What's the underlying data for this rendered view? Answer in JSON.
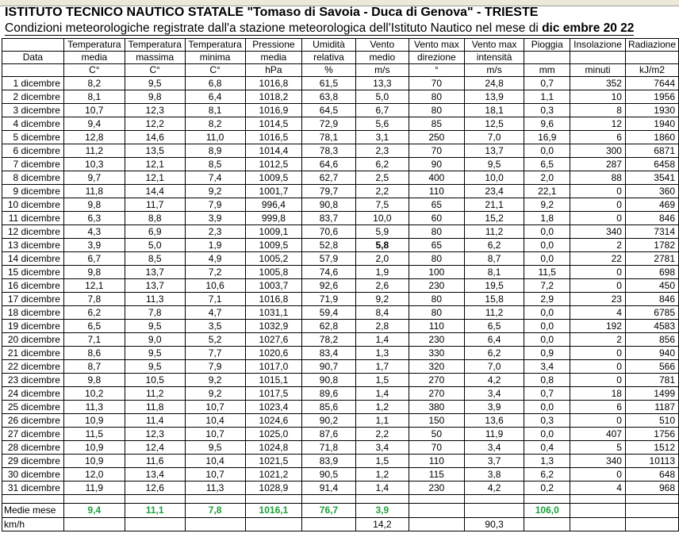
{
  "title": "ISTITUTO TECNICO NAUTICO STATALE \"Tomaso di Savoia - Duca di Genova\"  -  TRIESTE",
  "subtitle_main": "Condizioni meteorologiche registrate dall'a stazione meteorologica dell'Istituto Nautico nel mese di ",
  "subtitle_bold": "dic embre 20 22",
  "headers_row1": [
    "",
    "Temperatura",
    "Temperatura",
    "Temperatura",
    "Pressione",
    "Umidità",
    "Vento",
    "Vento max",
    "Vento max",
    "Pioggia",
    "Insolazione",
    "Radiazione"
  ],
  "headers_row2": [
    "Data",
    "media",
    "massima",
    "minima",
    "media",
    "relativa",
    "medio",
    "direzione",
    "intensità",
    "",
    "",
    ""
  ],
  "headers_row3": [
    "",
    "C°",
    "C°",
    "C°",
    "hPa",
    "%",
    "m/s",
    "°",
    "m/s",
    "mm",
    "minuti",
    "kJ/m2"
  ],
  "rows": [
    [
      "1 dicembre",
      "8,2",
      "9,5",
      "6,8",
      "1016,8",
      "61,5",
      "13,3",
      "70",
      "24,8",
      "0,7",
      "352",
      "7644"
    ],
    [
      "2 dicembre",
      "8,1",
      "9,8",
      "6,4",
      "1018,2",
      "63,8",
      "5,0",
      "80",
      "13,9",
      "1,1",
      "10",
      "1956"
    ],
    [
      "3 dicembre",
      "10,7",
      "12,3",
      "8,1",
      "1016,9",
      "64,5",
      "6,7",
      "80",
      "18,1",
      "0,3",
      "8",
      "1930"
    ],
    [
      "4 dicembre",
      "9,4",
      "12,2",
      "8,2",
      "1014,5",
      "72,9",
      "5,6",
      "85",
      "12,5",
      "9,6",
      "12",
      "1940"
    ],
    [
      "5 dicembre",
      "12,8",
      "14,6",
      "11,0",
      "1016,5",
      "78,1",
      "3,1",
      "250",
      "7,0",
      "16,9",
      "6",
      "1860"
    ],
    [
      "6 dicembre",
      "11,2",
      "13,5",
      "8,9",
      "1014,4",
      "78,3",
      "2,3",
      "70",
      "13,7",
      "0,0",
      "300",
      "6871"
    ],
    [
      "7 dicembre",
      "10,3",
      "12,1",
      "8,5",
      "1012,5",
      "64,6",
      "6,2",
      "90",
      "9,5",
      "6,5",
      "287",
      "6458"
    ],
    [
      "8 dicembre",
      "9,7",
      "12,1",
      "7,4",
      "1009,5",
      "62,7",
      "2,5",
      "400",
      "10,0",
      "2,0",
      "88",
      "3541"
    ],
    [
      "9 dicembre",
      "11,8",
      "14,4",
      "9,2",
      "1001,7",
      "79,7",
      "2,2",
      "110",
      "23,4",
      "22,1",
      "0",
      "360"
    ],
    [
      "10 dicembre",
      "9,8",
      "11,7",
      "7,9",
      "996,4",
      "90,8",
      "7,5",
      "65",
      "21,1",
      "9,2",
      "0",
      "469"
    ],
    [
      "11 dicembre",
      "6,3",
      "8,8",
      "3,9",
      "999,8",
      "83,7",
      "10,0",
      "60",
      "15,2",
      "1,8",
      "0",
      "846"
    ],
    [
      "12 dicembre",
      "4,3",
      "6,9",
      "2,3",
      "1009,1",
      "70,6",
      "5,9",
      "80",
      "11,2",
      "0,0",
      "340",
      "7314"
    ],
    [
      "13 dicembre",
      "3,9",
      "5,0",
      "1,9",
      "1009,5",
      "52,8",
      "5,8",
      "65",
      "6,2",
      "0,0",
      "2",
      "1782"
    ],
    [
      "14 dicembre",
      "6,7",
      "8,5",
      "4,9",
      "1005,2",
      "57,9",
      "2,0",
      "80",
      "8,7",
      "0,0",
      "22",
      "2781"
    ],
    [
      "15 dicembre",
      "9,8",
      "13,7",
      "7,2",
      "1005,8",
      "74,6",
      "1,9",
      "100",
      "8,1",
      "11,5",
      "0",
      "698"
    ],
    [
      "16 dicembre",
      "12,1",
      "13,7",
      "10,6",
      "1003,7",
      "92,6",
      "2,6",
      "230",
      "19,5",
      "7,2",
      "0",
      "450"
    ],
    [
      "17 dicembre",
      "7,8",
      "11,3",
      "7,1",
      "1016,8",
      "71,9",
      "9,2",
      "80",
      "15,8",
      "2,9",
      "23",
      "846"
    ],
    [
      "18 dicembre",
      "6,2",
      "7,8",
      "4,7",
      "1031,1",
      "59,4",
      "8,4",
      "80",
      "11,2",
      "0,0",
      "4",
      "6785"
    ],
    [
      "19 dicembre",
      "6,5",
      "9,5",
      "3,5",
      "1032,9",
      "62,8",
      "2,8",
      "110",
      "6,5",
      "0,0",
      "192",
      "4583"
    ],
    [
      "20 dicembre",
      "7,1",
      "9,0",
      "5,2",
      "1027,6",
      "78,2",
      "1,4",
      "230",
      "6,4",
      "0,0",
      "2",
      "856"
    ],
    [
      "21 dicembre",
      "8,6",
      "9,5",
      "7,7",
      "1020,6",
      "83,4",
      "1,3",
      "330",
      "6,2",
      "0,9",
      "0",
      "940"
    ],
    [
      "22 dicembre",
      "8,7",
      "9,5",
      "7,9",
      "1017,0",
      "90,7",
      "1,7",
      "320",
      "7,0",
      "3,4",
      "0",
      "566"
    ],
    [
      "23 dicembre",
      "9,8",
      "10,5",
      "9,2",
      "1015,1",
      "90,8",
      "1,5",
      "270",
      "4,2",
      "0,8",
      "0",
      "781"
    ],
    [
      "24 dicembre",
      "10,2",
      "11,2",
      "9,2",
      "1017,5",
      "89,6",
      "1,4",
      "270",
      "3,4",
      "0,7",
      "18",
      "1499"
    ],
    [
      "25 dicembre",
      "11,3",
      "11,8",
      "10,7",
      "1023,4",
      "85,6",
      "1,2",
      "380",
      "3,9",
      "0,0",
      "6",
      "1187"
    ],
    [
      "26 dicembre",
      "10,9",
      "11,4",
      "10,4",
      "1024,6",
      "90,2",
      "1,1",
      "150",
      "13,6",
      "0,3",
      "0",
      "510"
    ],
    [
      "27 dicembre",
      "11,5",
      "12,3",
      "10,7",
      "1025,0",
      "87,6",
      "2,2",
      "50",
      "11,9",
      "0,0",
      "407",
      "1756"
    ],
    [
      "28 dicembre",
      "10,9",
      "12,4",
      "9,5",
      "1024,8",
      "71,8",
      "3,4",
      "70",
      "3,4",
      "0,4",
      "5",
      "1512"
    ],
    [
      "29 dicembre",
      "10,9",
      "11,6",
      "10,4",
      "1021,5",
      "83,9",
      "1,5",
      "110",
      "3,7",
      "1,3",
      "340",
      "10113"
    ],
    [
      "30 dicembre",
      "12,0",
      "13,4",
      "10,7",
      "1021,2",
      "90,5",
      "1,2",
      "115",
      "3,8",
      "6,2",
      "0",
      "648"
    ],
    [
      "31 dicembre",
      "11,9",
      "12,6",
      "11,3",
      "1028,9",
      "91,4",
      "1,4",
      "230",
      "4,2",
      "0,2",
      "4",
      "968"
    ]
  ],
  "averages": {
    "label": "Medie mese",
    "temp_media": "9,4",
    "temp_massima": "11,1",
    "temp_minima": "7,8",
    "pressione": "1016,1",
    "umidita": "76,7",
    "vento_medio": "3,9",
    "pioggia": "106,0"
  },
  "kmh": {
    "label": "km/h",
    "vento_medio": "14,2",
    "vento_max": "90,3"
  },
  "colors": {
    "green": "#1aa13a",
    "header_strip": "#ece9d8"
  }
}
